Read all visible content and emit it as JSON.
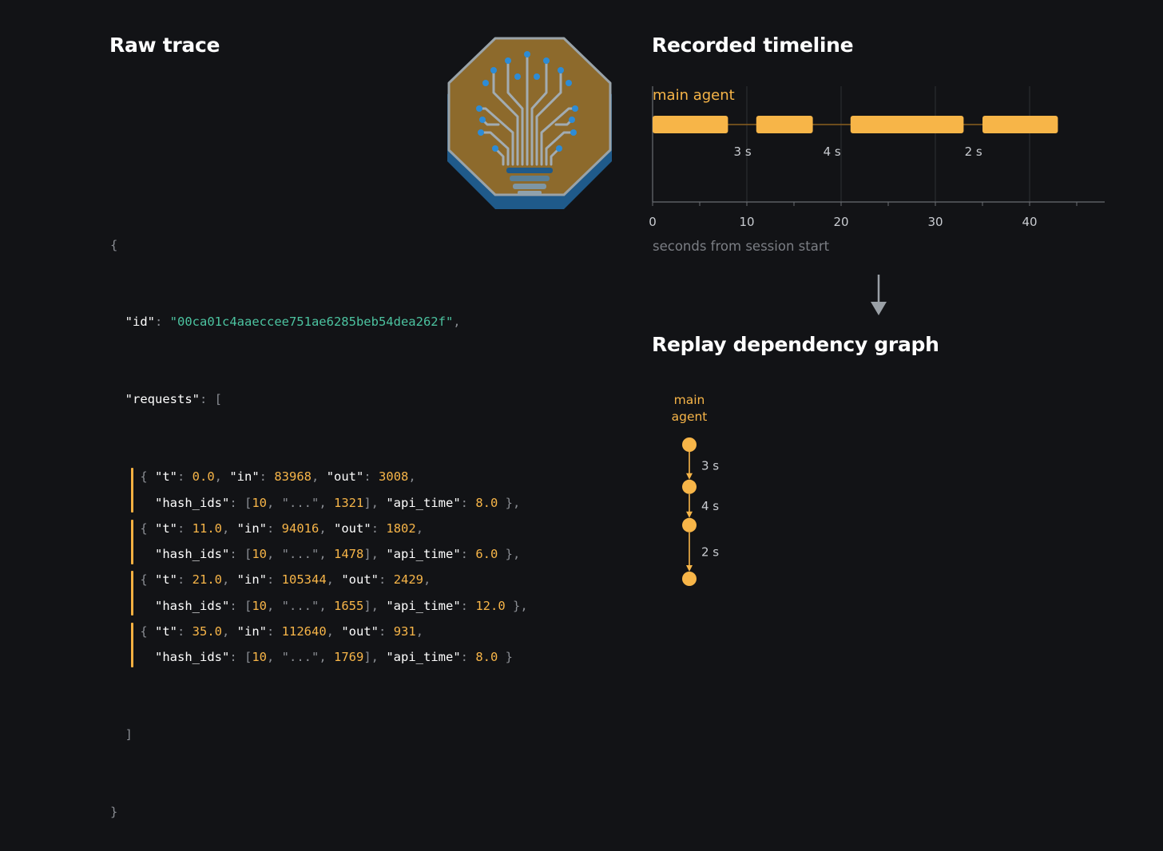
{
  "left_panel": {
    "title": "Raw trace",
    "id_key": "\"id\"",
    "id_value": "\"00ca01c4aaeccee751ae6285beb54dea262f\"",
    "requests_key": "\"requests\"",
    "requests": [
      {
        "t": "0.0",
        "in": "83968",
        "out": "3008",
        "hash_first": "10",
        "hash_mid": "\"...\"",
        "hash_last": "1321",
        "api_time": "8.0",
        "trail": " },"
      },
      {
        "t": "11.0",
        "in": "94016",
        "out": "1802",
        "hash_first": "10",
        "hash_mid": "\"...\"",
        "hash_last": "1478",
        "api_time": "6.0",
        "trail": " },"
      },
      {
        "t": "21.0",
        "in": "105344",
        "out": "2429",
        "hash_first": "10",
        "hash_mid": "\"...\"",
        "hash_last": "1655",
        "api_time": "12.0",
        "trail": " },"
      },
      {
        "t": "35.0",
        "in": "112640",
        "out": "931",
        "hash_first": "10",
        "hash_mid": "\"...\"",
        "hash_last": "1769",
        "api_time": "8.0",
        "trail": " }"
      }
    ]
  },
  "logo": {
    "icon": "circuit-tree-lightbulb-icon"
  },
  "timeline": {
    "title": "Recorded timeline",
    "lane_label": "main agent",
    "x_axis_label": "seconds from session start",
    "gap_labels": [
      "3 s",
      "4 s",
      "2 s"
    ]
  },
  "chart_data": {
    "type": "bar",
    "orientation": "horizontal-timeline",
    "series": [
      {
        "name": "main agent",
        "values": [
          [
            0,
            8
          ],
          [
            11,
            17
          ],
          [
            21,
            33
          ],
          [
            35,
            43
          ]
        ]
      }
    ],
    "gaps": [
      {
        "from": 8,
        "to": 11,
        "label": "3 s"
      },
      {
        "from": 17,
        "to": 21,
        "label": "4 s"
      },
      {
        "from": 33,
        "to": 35,
        "label": "2 s"
      }
    ],
    "xlabel": "seconds from session start",
    "xlim": [
      0,
      48
    ],
    "xticks": [
      0,
      10,
      20,
      30,
      40
    ],
    "grid": true
  },
  "graph": {
    "title": "Replay dependency graph",
    "node_label_lines": [
      "main",
      "agent"
    ],
    "edge_labels": [
      "3 s",
      "4 s",
      "2 s"
    ]
  },
  "colors": {
    "accent": "#f7b548",
    "background": "#121316",
    "id_string": "#4cc3a0",
    "muted": "#8a8d93"
  }
}
